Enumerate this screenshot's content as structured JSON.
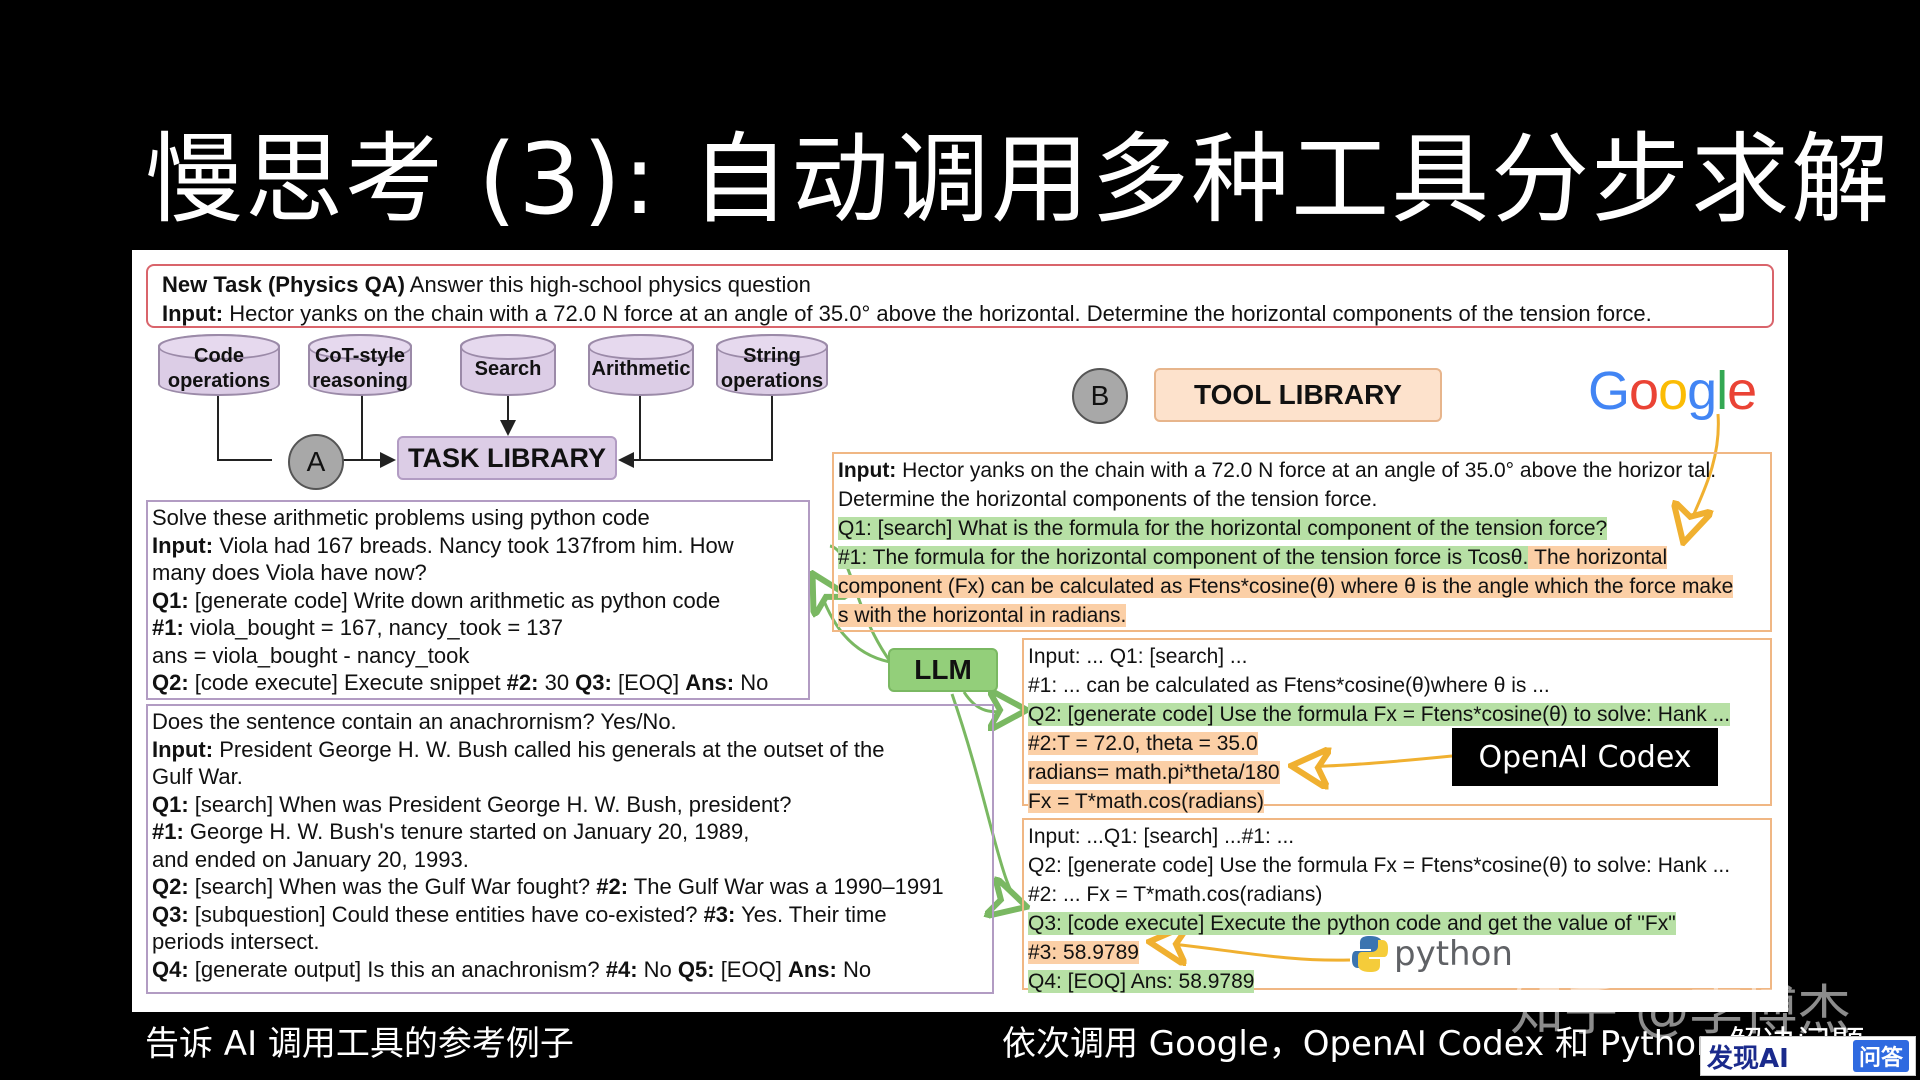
{
  "title": "慢思考 (3): 自动调用多种工具分步求解",
  "task": {
    "head_bold": "New Task (Physics QA)",
    "head_rest": " Answer this high-school physics question",
    "input_label": "Input:",
    "input_text": " Hector yanks on the chain with a 72.0 N force at an angle of 35.0° above the horizontal. Determine the horizontal components of the tension force."
  },
  "task_types": [
    "Code\noperations",
    "CoT-style\nreasoning",
    "Search",
    "Arithmetic",
    "String\noperations"
  ],
  "task_library_label": "TASK LIBRARY",
  "tool_library_label": "TOOL LIBRARY",
  "marker_a": "A",
  "marker_b": "B",
  "google_logo": "Google",
  "example1": {
    "l1": "Solve these arithmetic problems using python code",
    "l2a": "Input:",
    "l2b": " Viola had 167 breads. Nancy took 137from him. How",
    "l3": "many does Viola have now?",
    "l4a": "Q1:",
    "l4b": " [generate code] Write down arithmetic as python code",
    "l5a": "#1:",
    "l5b": " viola_bought = 167, nancy_took = 137",
    "l6": "ans = viola_bought - nancy_took",
    "l7a": "Q2:",
    "l7b": " [code execute] Execute snippet ",
    "l7c": "#2:",
    "l7d": " 30 ",
    "l7e": "Q3:",
    "l7f": " [EOQ] ",
    "l7g": "Ans:",
    "l7h": " No"
  },
  "example2": {
    "l1": "Does the sentence contain an anachrornism? Yes/No.",
    "l2a": "Input:",
    "l2b": " President George H. W. Bush called his generals at the outset of the",
    "l3": "Gulf War.",
    "l4a": "Q1:",
    "l4b": " [search] When was President George H. W. Bush, president?",
    "l5a": "#1:",
    "l5b": " George H. W. Bush's tenure started on January 20, 1989,",
    "l6": "and ended on January 20, 1993.",
    "l7a": "Q2:",
    "l7b": " [search] When was the Gulf War fought? ",
    "l7c": "#2:",
    "l7d": " The Gulf War was a 1990–1991",
    "l8a": "Q3:",
    "l8b": " [subquestion] Could these entities have co-existed? ",
    "l8c": "#3:",
    "l8d": " Yes. Their time",
    "l9": "periods intersect.",
    "l10a": "Q4:",
    "l10b": " [generate output] Is this an anachronism? ",
    "l10c": "#4:",
    "l10d": " No ",
    "l10e": "Q5:",
    "l10f": " [EOQ] ",
    "l10g": "Ans:",
    "l10h": " No"
  },
  "output1": {
    "l1a": "Input:",
    "l1b": " Hector yanks on the chain with a 72.0 N force at an angle of 35.0° above the horizor tal.",
    "l2": "Determine the horizontal components of the tension force.",
    "l3": "Q1: [search] What is the formula for the horizontal component of the tension force?",
    "l4a": "#1: The formula for the horizontal component of the tension force is Tcosθ.",
    "l4b": " The horizontal",
    "l5": "component (Fx) can be calculated as Ftens*cosine(θ) where θ is the angle which the force make",
    "l6": "s with the horizontal in radians."
  },
  "output2": {
    "l1": "Input: ... Q1: [search] ...",
    "l2": "#1: ... can be calculated as Ftens*cosine(θ)where θ is ...",
    "l3": "Q2: [generate code] Use the formula Fx = Ftens*cosine(θ) to solve: Hank ...",
    "l4": "#2:T = 72.0, theta = 35.0",
    "l5": "radians= math.pi*theta/180",
    "l6": "Fx = T*math.cos(radians)"
  },
  "output3": {
    "l1": "Input: ...Q1: [search] ...#1: ...",
    "l2": "Q2: [generate code] Use the formula Fx = Ftens*cosine(θ) to solve: Hank ...",
    "l3": "#2: ... Fx = T*math.cos(radians)",
    "l4": "Q3: [code execute] Execute the python code and get the value of \"Fx\"",
    "l5": "#3: 58.9789",
    "l6": "Q4: [EOQ] Ans: 58.9789"
  },
  "llm_label": "LLM",
  "codex_label": "OpenAI Codex",
  "python_label": "python",
  "caption_left": "告诉 AI 调用工具的参考例子",
  "caption_right": "依次调用 Google，OpenAI Codex 和 Python 解决问题",
  "watermark": "知乎 @李博杰",
  "badge": {
    "name": "发现AI",
    "qa": "问答"
  },
  "colors": {
    "green_highlight": "#b7e0a5",
    "orange_highlight": "#fbcfa6",
    "purple": "#dccde6",
    "arrow_orange": "#f0b030",
    "arrow_green": "#7ab862"
  }
}
